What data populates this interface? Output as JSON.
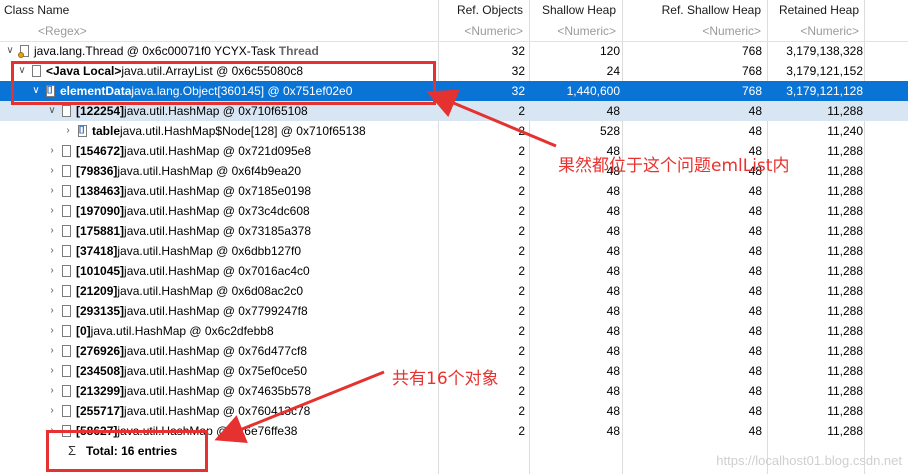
{
  "columns": {
    "class_name": "Class Name",
    "ref_objects": "Ref. Objects",
    "shallow_heap": "Shallow Heap",
    "ref_shallow_heap": "Ref. Shallow Heap",
    "retained_heap": "Retained Heap"
  },
  "filters": {
    "class_name": "<Regex>",
    "ref_objects": "<Numeric>",
    "shallow_heap": "<Numeric>",
    "ref_shallow_heap": "<Numeric>",
    "retained_heap": "<Numeric>"
  },
  "thread_row": {
    "prefix": "",
    "bold": "",
    "rest": "java.lang.Thread @ 0x6c00071f0  YCYX-Task",
    "suffix": "Thread",
    "ref": "32",
    "shallow": "120",
    "refshallow": "768",
    "retained": "3,179,138,328"
  },
  "local_row": {
    "bold": "<Java Local>",
    "rest": " java.util.ArrayList @ 0x6c55080c8",
    "ref": "32",
    "shallow": "24",
    "refshallow": "768",
    "retained": "3,179,121,152"
  },
  "element_row": {
    "bold": "elementData",
    "rest": " java.lang.Object[360145] @ 0x751ef02e0",
    "ref": "32",
    "shallow": "1,440,600",
    "refshallow": "768",
    "retained": "3,179,121,128"
  },
  "hashmap_rows": [
    {
      "bold": "[122254]",
      "rest": " java.util.HashMap @ 0x710f65108",
      "ref": "2",
      "shallow": "48",
      "refshallow": "48",
      "retained": "11,288"
    },
    {
      "bold": "table",
      "rest": " java.util.HashMap$Node[128] @ 0x710f65138",
      "ref": "2",
      "shallow": "528",
      "refshallow": "48",
      "retained": "11,240"
    },
    {
      "bold": "[154672]",
      "rest": " java.util.HashMap @ 0x721d095e8",
      "ref": "2",
      "shallow": "48",
      "refshallow": "48",
      "retained": "11,288"
    },
    {
      "bold": "[79836]",
      "rest": " java.util.HashMap @ 0x6f4b9ea20",
      "ref": "2",
      "shallow": "48",
      "refshallow": "48",
      "retained": "11,288"
    },
    {
      "bold": "[138463]",
      "rest": " java.util.HashMap @ 0x7185e0198",
      "ref": "2",
      "shallow": "48",
      "refshallow": "48",
      "retained": "11,288"
    },
    {
      "bold": "[197090]",
      "rest": " java.util.HashMap @ 0x73c4dc608",
      "ref": "2",
      "shallow": "48",
      "refshallow": "48",
      "retained": "11,288"
    },
    {
      "bold": "[175881]",
      "rest": " java.util.HashMap @ 0x73185a378",
      "ref": "2",
      "shallow": "48",
      "refshallow": "48",
      "retained": "11,288"
    },
    {
      "bold": "[37418]",
      "rest": " java.util.HashMap @ 0x6dbb127f0",
      "ref": "2",
      "shallow": "48",
      "refshallow": "48",
      "retained": "11,288"
    },
    {
      "bold": "[101045]",
      "rest": " java.util.HashMap @ 0x7016ac4c0",
      "ref": "2",
      "shallow": "48",
      "refshallow": "48",
      "retained": "11,288"
    },
    {
      "bold": "[21209]",
      "rest": " java.util.HashMap @ 0x6d08ac2c0",
      "ref": "2",
      "shallow": "48",
      "refshallow": "48",
      "retained": "11,288"
    },
    {
      "bold": "[293135]",
      "rest": " java.util.HashMap @ 0x7799247f8",
      "ref": "2",
      "shallow": "48",
      "refshallow": "48",
      "retained": "11,288"
    },
    {
      "bold": "[0]",
      "rest": " java.util.HashMap @ 0x6c2dfebb8",
      "ref": "2",
      "shallow": "48",
      "refshallow": "48",
      "retained": "11,288"
    },
    {
      "bold": "[276926]",
      "rest": " java.util.HashMap @ 0x76d477cf8",
      "ref": "2",
      "shallow": "48",
      "refshallow": "48",
      "retained": "11,288"
    },
    {
      "bold": "[234508]",
      "rest": " java.util.HashMap @ 0x75ef0ce50",
      "ref": "2",
      "shallow": "48",
      "refshallow": "48",
      "retained": "11,288"
    },
    {
      "bold": "[213299]",
      "rest": " java.util.HashMap @ 0x74635b578",
      "ref": "2",
      "shallow": "48",
      "refshallow": "48",
      "retained": "11,288"
    },
    {
      "bold": "[255717]",
      "rest": " java.util.HashMap @ 0x760413c78",
      "ref": "2",
      "shallow": "48",
      "refshallow": "48",
      "retained": "11,288"
    },
    {
      "bold": "[58627]",
      "rest": " java.util.HashMap @ 0x6e76ffe38",
      "ref": "2",
      "shallow": "48",
      "refshallow": "48",
      "retained": "11,288"
    }
  ],
  "total_row": {
    "label": "Total: 16 entries"
  },
  "annotations": {
    "note1": "果然都位于这个问题emlList内",
    "note2": "共有16个对象"
  },
  "watermark": "https://localhost01.blog.csdn.net",
  "colors": {
    "selection": "#0a74d6",
    "highlight": "#d8e6f3",
    "annotation": "#e5312f"
  }
}
